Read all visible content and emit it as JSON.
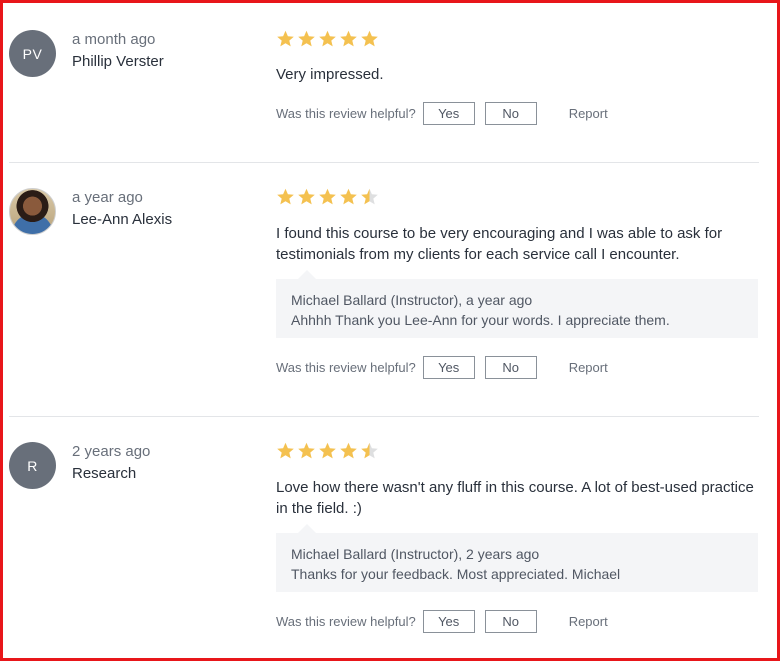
{
  "colors": {
    "star": "#f4c150",
    "star_empty": "#dedfe0",
    "frame": "#e8161a",
    "avatar_bg": "#686f7a",
    "response_bg": "#f4f5f7"
  },
  "helpful_prompt": "Was this review helpful?",
  "yes_label": "Yes",
  "no_label": "No",
  "report_label": "Report",
  "reviews": [
    {
      "initials": "PV",
      "time": "a month ago",
      "name": "Phillip Verster",
      "rating": 5,
      "text": "Very impressed."
    },
    {
      "avatar": "user-photo",
      "time": "a year ago",
      "name": "Lee-Ann Alexis",
      "rating": 4.5,
      "text": "I found this course to be very encouraging and I was able to ask for testimonials from my clients for each service call I encounter.",
      "response": {
        "header": "Michael Ballard (Instructor), a year ago",
        "text": "Ahhhh Thank you Lee-Ann for your words. I appreciate them."
      }
    },
    {
      "initials": "R",
      "time": "2 years ago",
      "name": "Research",
      "rating": 4.5,
      "text": "Love how there wasn't any fluff in this course. A lot of best-used practice in the field. :)",
      "response": {
        "header": "Michael Ballard (Instructor), 2 years ago",
        "text": "Thanks for your feedback. Most appreciated. Michael"
      }
    }
  ]
}
